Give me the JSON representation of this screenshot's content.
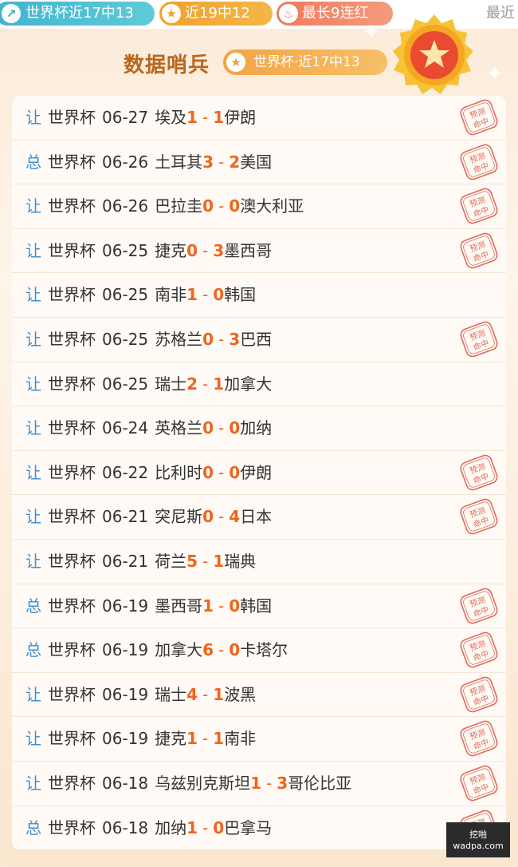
{
  "header": {
    "pills": [
      {
        "icon": "arrow-up-icon",
        "label": "世界杯近17中13"
      },
      {
        "icon": "star-icon",
        "label": "近19中12"
      },
      {
        "icon": "flame-icon",
        "label": "最长9连红"
      }
    ],
    "recent_label": "最近"
  },
  "card": {
    "title": "数据哨兵",
    "tag": "世界杯·近17中13"
  },
  "colors": {
    "score": "#f0641e",
    "type": "#3f8fd4",
    "title": "#b8671f",
    "stamp": "#e06a5a"
  },
  "stamp_text": "预测命中",
  "predictions": [
    {
      "type": "让",
      "competition": "世界杯",
      "date": "06-27",
      "home": "埃及",
      "home_score": "1",
      "away_score": "1",
      "away": "伊朗",
      "hit": true
    },
    {
      "type": "总",
      "competition": "世界杯",
      "date": "06-26",
      "home": "土耳其",
      "home_score": "3",
      "away_score": "2",
      "away": "美国",
      "hit": true
    },
    {
      "type": "让",
      "competition": "世界杯",
      "date": "06-26",
      "home": "巴拉圭",
      "home_score": "0",
      "away_score": "0",
      "away": "澳大利亚",
      "hit": true
    },
    {
      "type": "让",
      "competition": "世界杯",
      "date": "06-25",
      "home": "捷克",
      "home_score": "0",
      "away_score": "3",
      "away": "墨西哥",
      "hit": true
    },
    {
      "type": "让",
      "competition": "世界杯",
      "date": "06-25",
      "home": "南非",
      "home_score": "1",
      "away_score": "0",
      "away": "韩国",
      "hit": false
    },
    {
      "type": "让",
      "competition": "世界杯",
      "date": "06-25",
      "home": "苏格兰",
      "home_score": "0",
      "away_score": "3",
      "away": "巴西",
      "hit": true
    },
    {
      "type": "让",
      "competition": "世界杯",
      "date": "06-25",
      "home": "瑞士",
      "home_score": "2",
      "away_score": "1",
      "away": "加拿大",
      "hit": false
    },
    {
      "type": "让",
      "competition": "世界杯",
      "date": "06-24",
      "home": "英格兰",
      "home_score": "0",
      "away_score": "0",
      "away": "加纳",
      "hit": false
    },
    {
      "type": "让",
      "competition": "世界杯",
      "date": "06-22",
      "home": "比利时",
      "home_score": "0",
      "away_score": "0",
      "away": "伊朗",
      "hit": true
    },
    {
      "type": "让",
      "competition": "世界杯",
      "date": "06-21",
      "home": "突尼斯",
      "home_score": "0",
      "away_score": "4",
      "away": "日本",
      "hit": true
    },
    {
      "type": "让",
      "competition": "世界杯",
      "date": "06-21",
      "home": "荷兰",
      "home_score": "5",
      "away_score": "1",
      "away": "瑞典",
      "hit": false
    },
    {
      "type": "总",
      "competition": "世界杯",
      "date": "06-19",
      "home": "墨西哥",
      "home_score": "1",
      "away_score": "0",
      "away": "韩国",
      "hit": true
    },
    {
      "type": "总",
      "competition": "世界杯",
      "date": "06-19",
      "home": "加拿大",
      "home_score": "6",
      "away_score": "0",
      "away": "卡塔尔",
      "hit": true
    },
    {
      "type": "让",
      "competition": "世界杯",
      "date": "06-19",
      "home": "瑞士",
      "home_score": "4",
      "away_score": "1",
      "away": "波黑",
      "hit": true
    },
    {
      "type": "让",
      "competition": "世界杯",
      "date": "06-19",
      "home": "捷克",
      "home_score": "1",
      "away_score": "1",
      "away": "南非",
      "hit": true
    },
    {
      "type": "让",
      "competition": "世界杯",
      "date": "06-18",
      "home": "乌兹别克斯坦",
      "home_score": "1",
      "away_score": "3",
      "away": "哥伦比亚",
      "hit": true
    },
    {
      "type": "总",
      "competition": "世界杯",
      "date": "06-18",
      "home": "加纳",
      "home_score": "1",
      "away_score": "0",
      "away": "巴拿马",
      "hit": true
    }
  ],
  "watermark": {
    "line1": "挖啪",
    "line2": "wadpa.com"
  }
}
